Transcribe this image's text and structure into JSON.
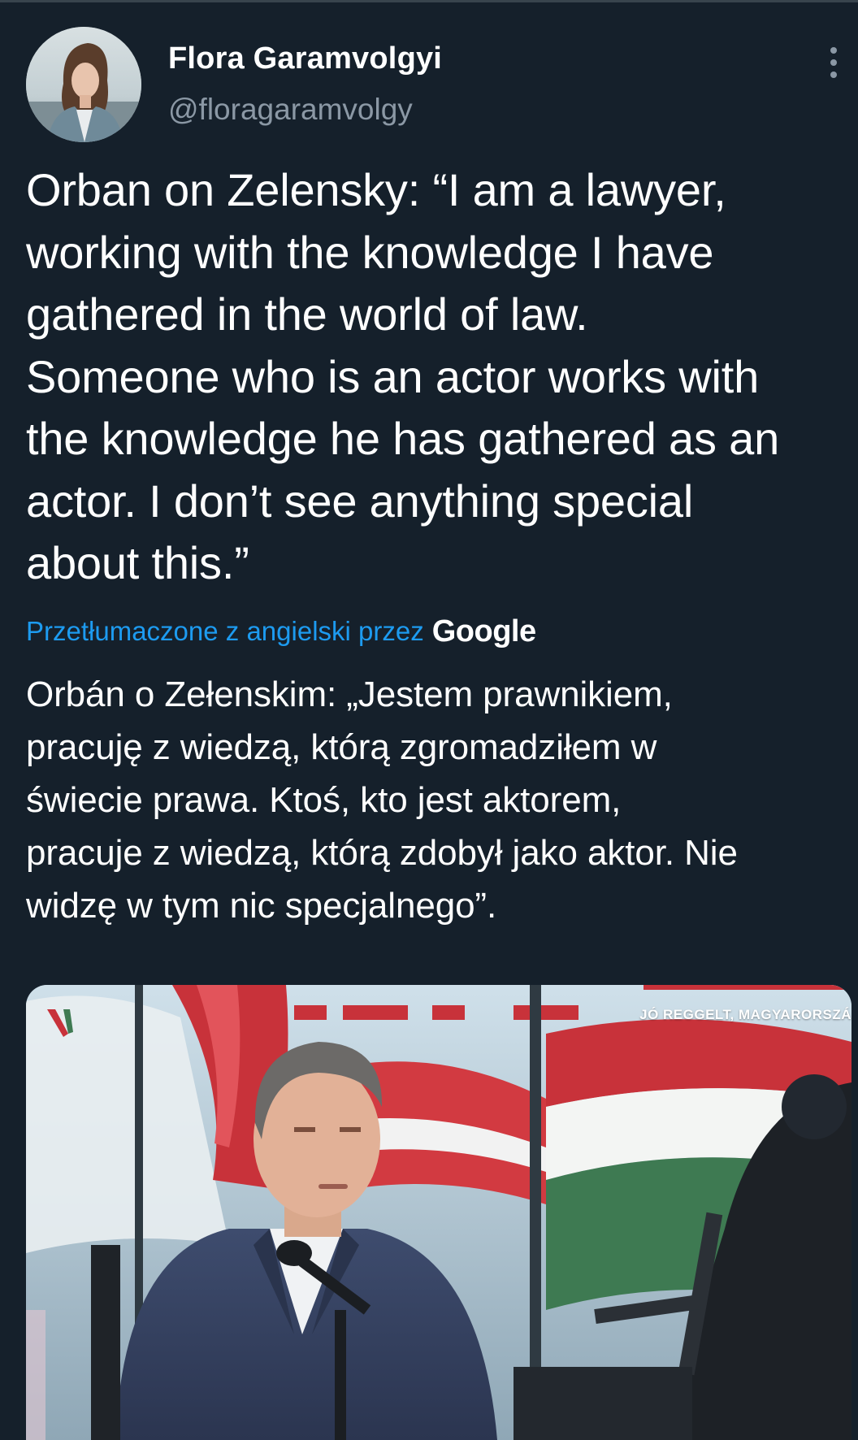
{
  "author": {
    "display_name": "Flora Garamvolgyi",
    "handle": "@floragaramvolgy"
  },
  "tweet": {
    "lines": [
      "Orban on Zelensky: “I am a lawyer,",
      "working with the knowledge I have",
      "gathered in the world of law.",
      "Someone who is an actor works with",
      "the knowledge he has gathered as an",
      "actor. I don’t see anything special",
      "about this.”"
    ]
  },
  "translation": {
    "link_text": "Przetłumaczone z angielski przez",
    "provider": "Google",
    "lines": [
      "Orbán o Zełenskim: „Jestem prawnikiem,",
      "pracuję z wiedzą, którą zgromadziłem w",
      "świecie prawa. Ktoś, kto jest aktorem,",
      "pracuje z wiedzą, którą zdobył jako aktor. Nie",
      "widzę w tym nic specjalnego”."
    ]
  },
  "media": {
    "caption": "JÓ REGGELT, MAGYARORSZÁ"
  },
  "colors": {
    "background": "#15202b",
    "link": "#1d9bf0",
    "secondary_text": "#8b98a5"
  },
  "icons": {
    "more": "more-vertical-icon"
  }
}
